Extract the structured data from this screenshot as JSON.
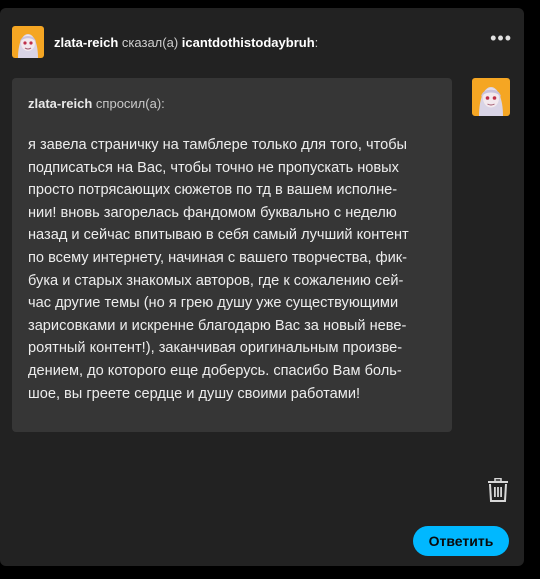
{
  "header": {
    "author": "zlata-reich",
    "verb": " сказал(а) ",
    "reblogged_from": "icantdothistodaybruh",
    "suffix": ":",
    "more_label": "•••"
  },
  "ask": {
    "asker": "zlata-reich",
    "verb": " спросил(а):",
    "text": "я завела страничку на тамблере только для того, чтобы\nподписаться на Вас, чтобы точно не пропускать новых\nпросто потрясающих сюжетов по тд в вашем исполне-\nнии! вновь загорелась фандомом буквально с неделю\nназад и сейчас впитываю в себя самый лучший контент\nпо всему интернету, начиная с вашего творчества, фик-\nбука и старых знакомых авторов, где к сожалению сей-\nчас другие темы (но я грею душу уже существующими\nзарисовками и искренне благодарю Вас за новый неве-\nроятный контент!), заканчивая оригинальным произве-\nдением, до которого еще доберусь. спасибо Вам боль-\nшое, вы греете сердце и душу своими работами!"
  },
  "actions": {
    "reply_label": "Ответить"
  },
  "colors": {
    "card_bg": "#222222",
    "ask_bg": "#363636",
    "accent": "#00b8ff",
    "avatar_bg": "#f5a623"
  },
  "icons": {
    "more": "more-horizontal-icon",
    "delete": "trash-icon"
  }
}
